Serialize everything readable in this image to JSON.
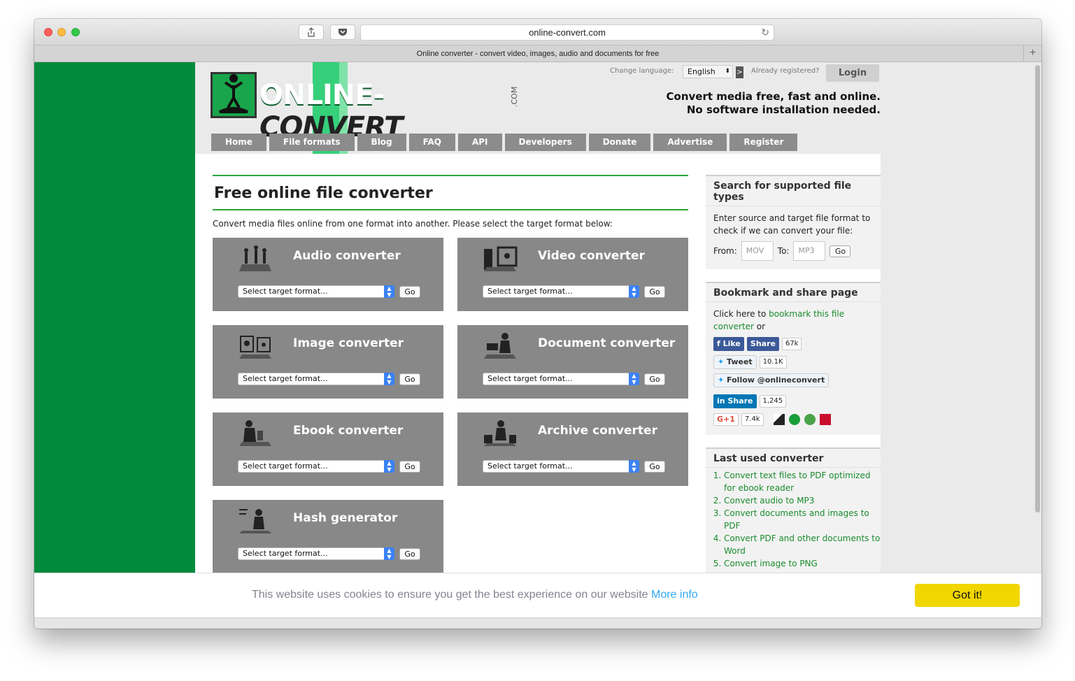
{
  "browser": {
    "url": "online-convert.com",
    "tab_title": "Online converter - convert video, images, audio and documents for free"
  },
  "header": {
    "logo_online": "ONLINE-",
    "logo_convert": "CONVERT",
    "logo_com": ".COM",
    "change_language_label": "Change language:",
    "language_value": "English",
    "language_go": ">",
    "already_registered": "Already registered?",
    "login_label": "Login",
    "tagline_line1": "Convert media free, fast and online.",
    "tagline_line2": "No software installation needed."
  },
  "nav": [
    "Home",
    "File formats",
    "Blog",
    "FAQ",
    "API",
    "Developers",
    "Donate",
    "Advertise",
    "Register"
  ],
  "main": {
    "title": "Free online file converter",
    "intro": "Convert media files online from one format into another. Please select the target format below:",
    "select_placeholder": "Select target format...",
    "go_label": "Go",
    "converters": [
      {
        "title": "Audio converter",
        "icon": "audio-converter-icon"
      },
      {
        "title": "Video converter",
        "icon": "video-converter-icon"
      },
      {
        "title": "Image converter",
        "icon": "image-converter-icon"
      },
      {
        "title": "Document converter",
        "icon": "document-converter-icon"
      },
      {
        "title": "Ebook converter",
        "icon": "ebook-converter-icon"
      },
      {
        "title": "Archive converter",
        "icon": "archive-converter-icon"
      },
      {
        "title": "Hash generator",
        "icon": "hash-generator-icon"
      }
    ]
  },
  "sidebar": {
    "search_box": {
      "heading": "Search for supported file types",
      "text": "Enter source and target file format to check if we can convert your file:",
      "from_label": "From:",
      "from_placeholder": "MOV",
      "to_label": "To:",
      "to_placeholder": "MP3",
      "go_label": "Go"
    },
    "bookmark_box": {
      "heading": "Bookmark and share page",
      "text_before": "Click here to ",
      "link_text": "bookmark this file converter",
      "text_after": " or",
      "fb_like": "Like",
      "fb_share": "Share",
      "fb_count": "67k",
      "tweet": "Tweet",
      "tweet_count": "10.1K",
      "follow": "Follow @onlineconvert",
      "li_share": "Share",
      "li_count": "1,245",
      "gplus": "G+1",
      "gplus_count": "7.4k"
    },
    "last_used": {
      "heading": "Last used converter",
      "items": [
        "Convert text files to PDF optimized for ebook reader",
        "Convert audio to MP3",
        "Convert documents and images to PDF",
        "Convert PDF and other documents to Word",
        "Convert image to PNG"
      ]
    }
  },
  "cookie": {
    "text": "This website uses cookies to ensure you get the best experience on our website",
    "more_info": "More info",
    "button": "Got it!"
  },
  "colors": {
    "brand_green": "#008a3a",
    "link_green": "#1a8c2e",
    "converter_bg": "#888888",
    "cookie_button": "#f1d600"
  }
}
